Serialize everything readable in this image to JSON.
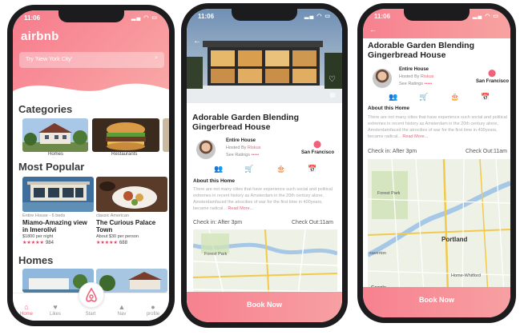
{
  "time": "11:06",
  "phone1": {
    "logo": "airbnb",
    "search_placeholder": "Try 'New York City'",
    "categories_title": "Categories",
    "categories": [
      "Homes",
      "Restaurants"
    ],
    "popular_title": "Most Popular",
    "popular": [
      {
        "sub": "Entire House - 6 beds",
        "title": "Miamo-Amazing view in Imerolivi",
        "price": "$1800 per night",
        "stars": "★★★★★",
        "count": "984"
      },
      {
        "sub": "classic American",
        "title": "The Curious Palace Town",
        "price": "About $30 per person",
        "stars": "★★★★★",
        "count": "688"
      }
    ],
    "homes_title": "Homes",
    "tabs": [
      "Home",
      "Likes",
      "Start",
      "Nav",
      "profile"
    ]
  },
  "detail": {
    "title": "Adorable Garden Blending Gingerbread House",
    "host_type": "Entire House",
    "hosted_by": "Hosted By",
    "host_name": "Riskus",
    "see_ratings": "See Ratings",
    "rating_dots": "•••••",
    "location": "San Francisco",
    "about_title": "About this Home",
    "about_text": "There are not many cities that have experience such social and political extremes in recent history as Amsterdam in the 20th century alone, Amsterdamfaced the atrocities of war for the first time in 400years, became radical...",
    "read_more": "Read More...",
    "check_in": "Check in: After 3pm",
    "check_out": "Check Out:11am",
    "map_labels": [
      "Forest Park",
      "Portland",
      "saverton",
      "Home-Whitford",
      "Google"
    ],
    "book": "Book Now"
  },
  "colors": {
    "accent": "#f0617a",
    "gradient_start": "#f77b8c",
    "gradient_end": "#f9a9a7"
  }
}
